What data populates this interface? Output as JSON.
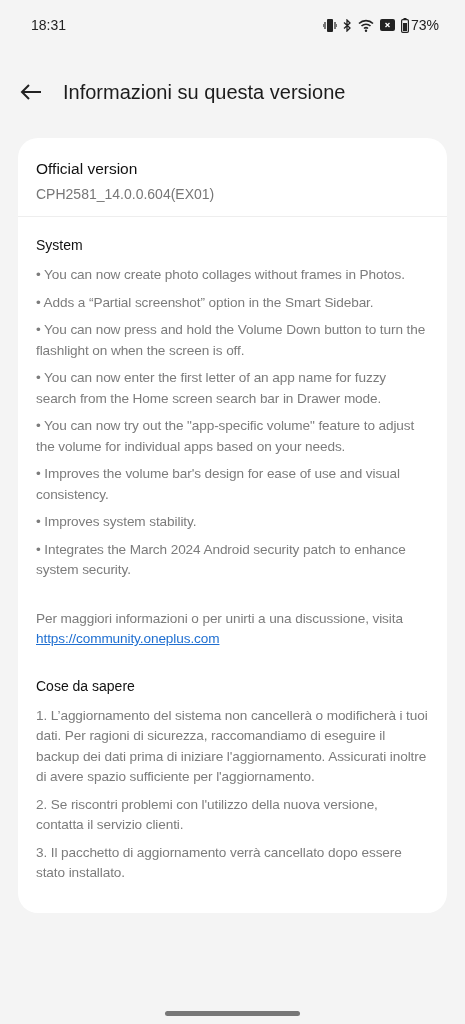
{
  "status_bar": {
    "time": "18:31",
    "battery": "73%"
  },
  "header": {
    "title": "Informazioni su questa versione"
  },
  "version": {
    "label": "Official version",
    "value": "CPH2581_14.0.0.604(EX01)"
  },
  "sections": [
    {
      "title": "System",
      "items": [
        "• You can now create photo collages without frames in Photos.",
        "• Adds a “Partial screenshot” option in the Smart Sidebar.",
        "• You can now press and hold the Volume Down button to turn the flashlight on when the screen is off.",
        "• You can now enter the first letter of an app name for fuzzy search from the Home screen search bar in Drawer mode.",
        "• You can now try out the \"app-specific volume\" feature to adjust the volume for individual apps based on your needs.",
        "• Improves the volume bar's design for ease of use and visual consistency.",
        "• Improves system stability.",
        "• Integrates the March 2024 Android security patch to enhance system security."
      ]
    }
  ],
  "more_info": {
    "text": "Per maggiori informazioni o per unirti a una discussione, visita",
    "link": "https://community.oneplus.com"
  },
  "notes": {
    "title": "Cose da sapere",
    "items": [
      "1. L’aggiornamento del sistema non cancellerà o modificherà i tuoi dati. Per ragioni di sicurezza, raccomandiamo di eseguire il backup dei dati prima di iniziare l'aggiornamento. Assicurati inoltre di avere spazio sufficiente per l'aggiornamento.",
      "2. Se riscontri problemi con l'utilizzo della nuova versione, contatta il servizio clienti.",
      "3. Il pacchetto di aggiornamento verrà cancellato dopo essere stato installato."
    ]
  }
}
